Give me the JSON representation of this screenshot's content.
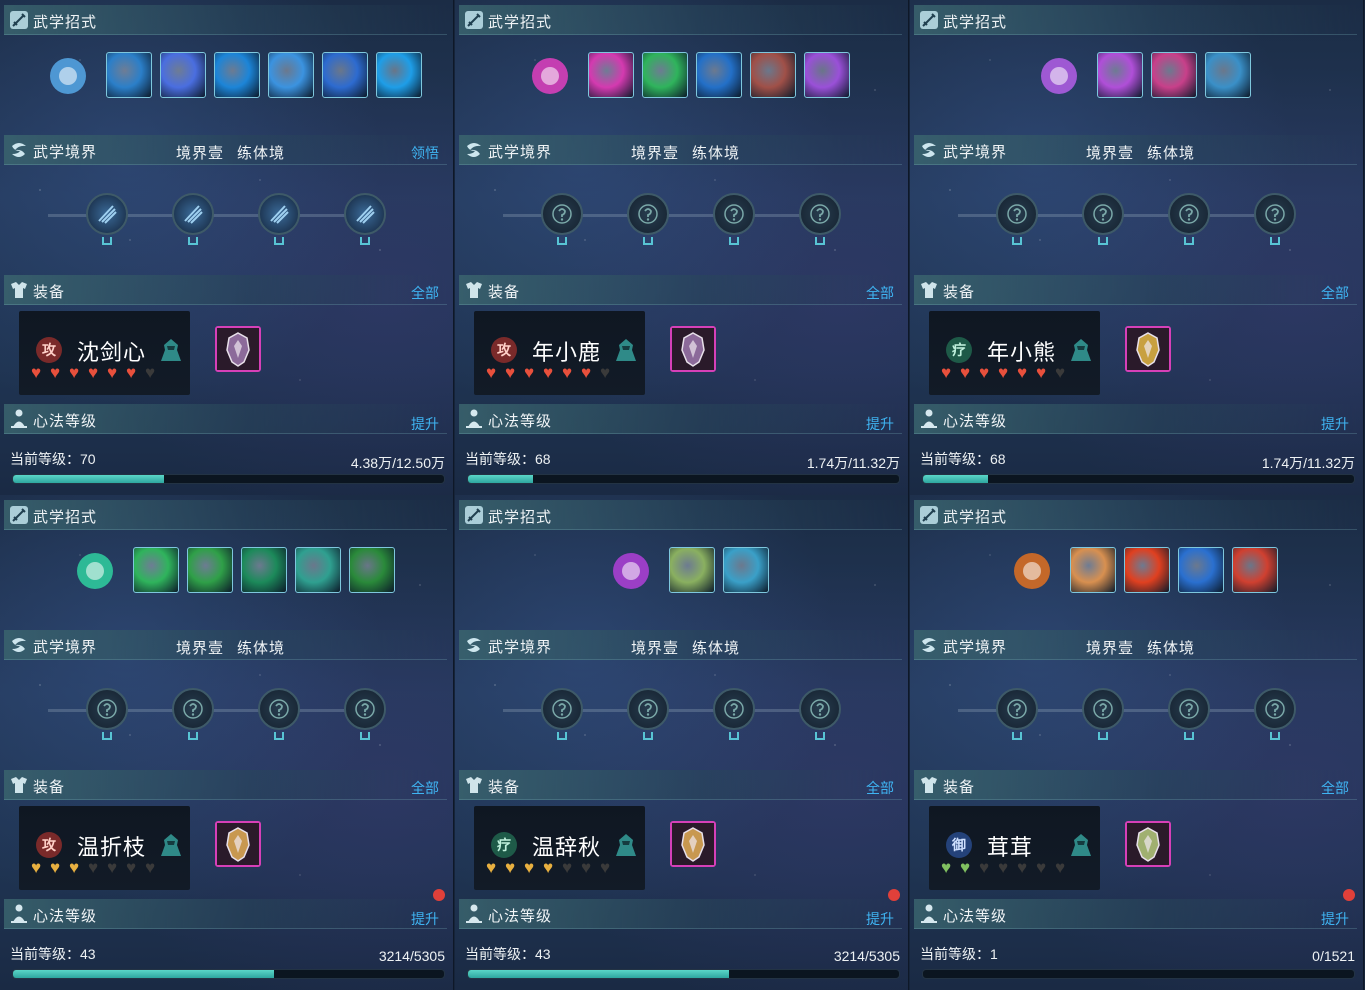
{
  "labels": {
    "skills": "武学招式",
    "realm": "武学境界",
    "realm_level": "境界壹",
    "realm_name": "练体境",
    "equip": "装备",
    "equip_all": "全部",
    "mind": "心法等级",
    "upgrade": "提升",
    "realize": "领悟"
  },
  "colors": {
    "accent_link": "#3fb4f2",
    "progress_fill": "#2ea6a0",
    "red_dot": "#e0403a"
  },
  "panels": [
    {
      "realm_link": "领悟",
      "realm_nodes": "unlocked",
      "character": {
        "name": "沈剑心",
        "role_glyph": "攻",
        "hearts_filled": 6,
        "hearts_total": 7,
        "heart_color": "#e8503c"
      },
      "level_label": "当前等级：70",
      "exp": "4.38万/12.50万",
      "progress": 0.35,
      "upgrade_dot": false,
      "skills": [
        "#2b7fc9",
        "#4a6ee0",
        "#1c85d8",
        "#3b93e0",
        "#2d6bd0",
        "#1e9ee8"
      ],
      "skill_main": "#56a8e8",
      "gear_color": "#8c6a9a"
    },
    {
      "realm_link": "",
      "realm_nodes": "locked",
      "character": {
        "name": "年小鹿",
        "role_glyph": "攻",
        "hearts_filled": 6,
        "hearts_total": 7,
        "heart_color": "#e8503c"
      },
      "level_label": "当前等级：68",
      "exp": "1.74万/11.32万",
      "progress": 0.15,
      "upgrade_dot": false,
      "skills": [
        "#d43ab0",
        "#2fb45c",
        "#2370c8",
        "#a05048",
        "#9a50d8"
      ],
      "skill_main": "#e040c0",
      "gear_color": "#8c6a9a"
    },
    {
      "realm_link": "",
      "realm_nodes": "locked",
      "character": {
        "name": "年小熊",
        "role_glyph": "疗",
        "hearts_filled": 6,
        "hearts_total": 7,
        "heart_color": "#e8503c"
      },
      "level_label": "当前等级：68",
      "exp": "1.74万/11.32万",
      "progress": 0.15,
      "upgrade_dot": false,
      "skills": [
        "#b04fd8",
        "#c8408a",
        "#3a90c8"
      ],
      "skill_main": "#b45ee8",
      "gear_color": "#c8a040"
    },
    {
      "realm_link": "",
      "realm_nodes": "locked",
      "character": {
        "name": "温折枝",
        "role_glyph": "攻",
        "hearts_filled": 2.5,
        "hearts_total": 7,
        "heart_color": "#e8b040"
      },
      "level_label": "当前等级：43",
      "exp": "3214/5305",
      "progress": 0.606,
      "upgrade_dot": true,
      "skills": [
        "#2fb45c",
        "#2fa048",
        "#1c8a5a",
        "#2fa090",
        "#2a8a3a"
      ],
      "skill_main": "#2fd0a0",
      "gear_color": "#c89850"
    },
    {
      "realm_link": "",
      "realm_nodes": "locked",
      "character": {
        "name": "温辞秋",
        "role_glyph": "疗",
        "hearts_filled": 4,
        "hearts_total": 7,
        "heart_color": "#e8b040"
      },
      "level_label": "当前等级：43",
      "exp": "3214/5305",
      "progress": 0.606,
      "upgrade_dot": true,
      "skills": [
        "#8ab060",
        "#3aa0c8"
      ],
      "skill_main": "#b040d8",
      "gear_color": "#c89850"
    },
    {
      "realm_link": "",
      "realm_nodes": "locked",
      "character": {
        "name": "茸茸",
        "role_glyph": "御",
        "hearts_filled": 2,
        "hearts_total": 7,
        "heart_color": "#80c060"
      },
      "level_label": "当前等级：1",
      "exp": "0/1521",
      "progress": 0.0,
      "upgrade_dot": true,
      "skills": [
        "#d89050",
        "#e04020",
        "#2a70d0",
        "#d04030"
      ],
      "skill_main": "#e07020",
      "gear_color": "#a0b070"
    }
  ]
}
